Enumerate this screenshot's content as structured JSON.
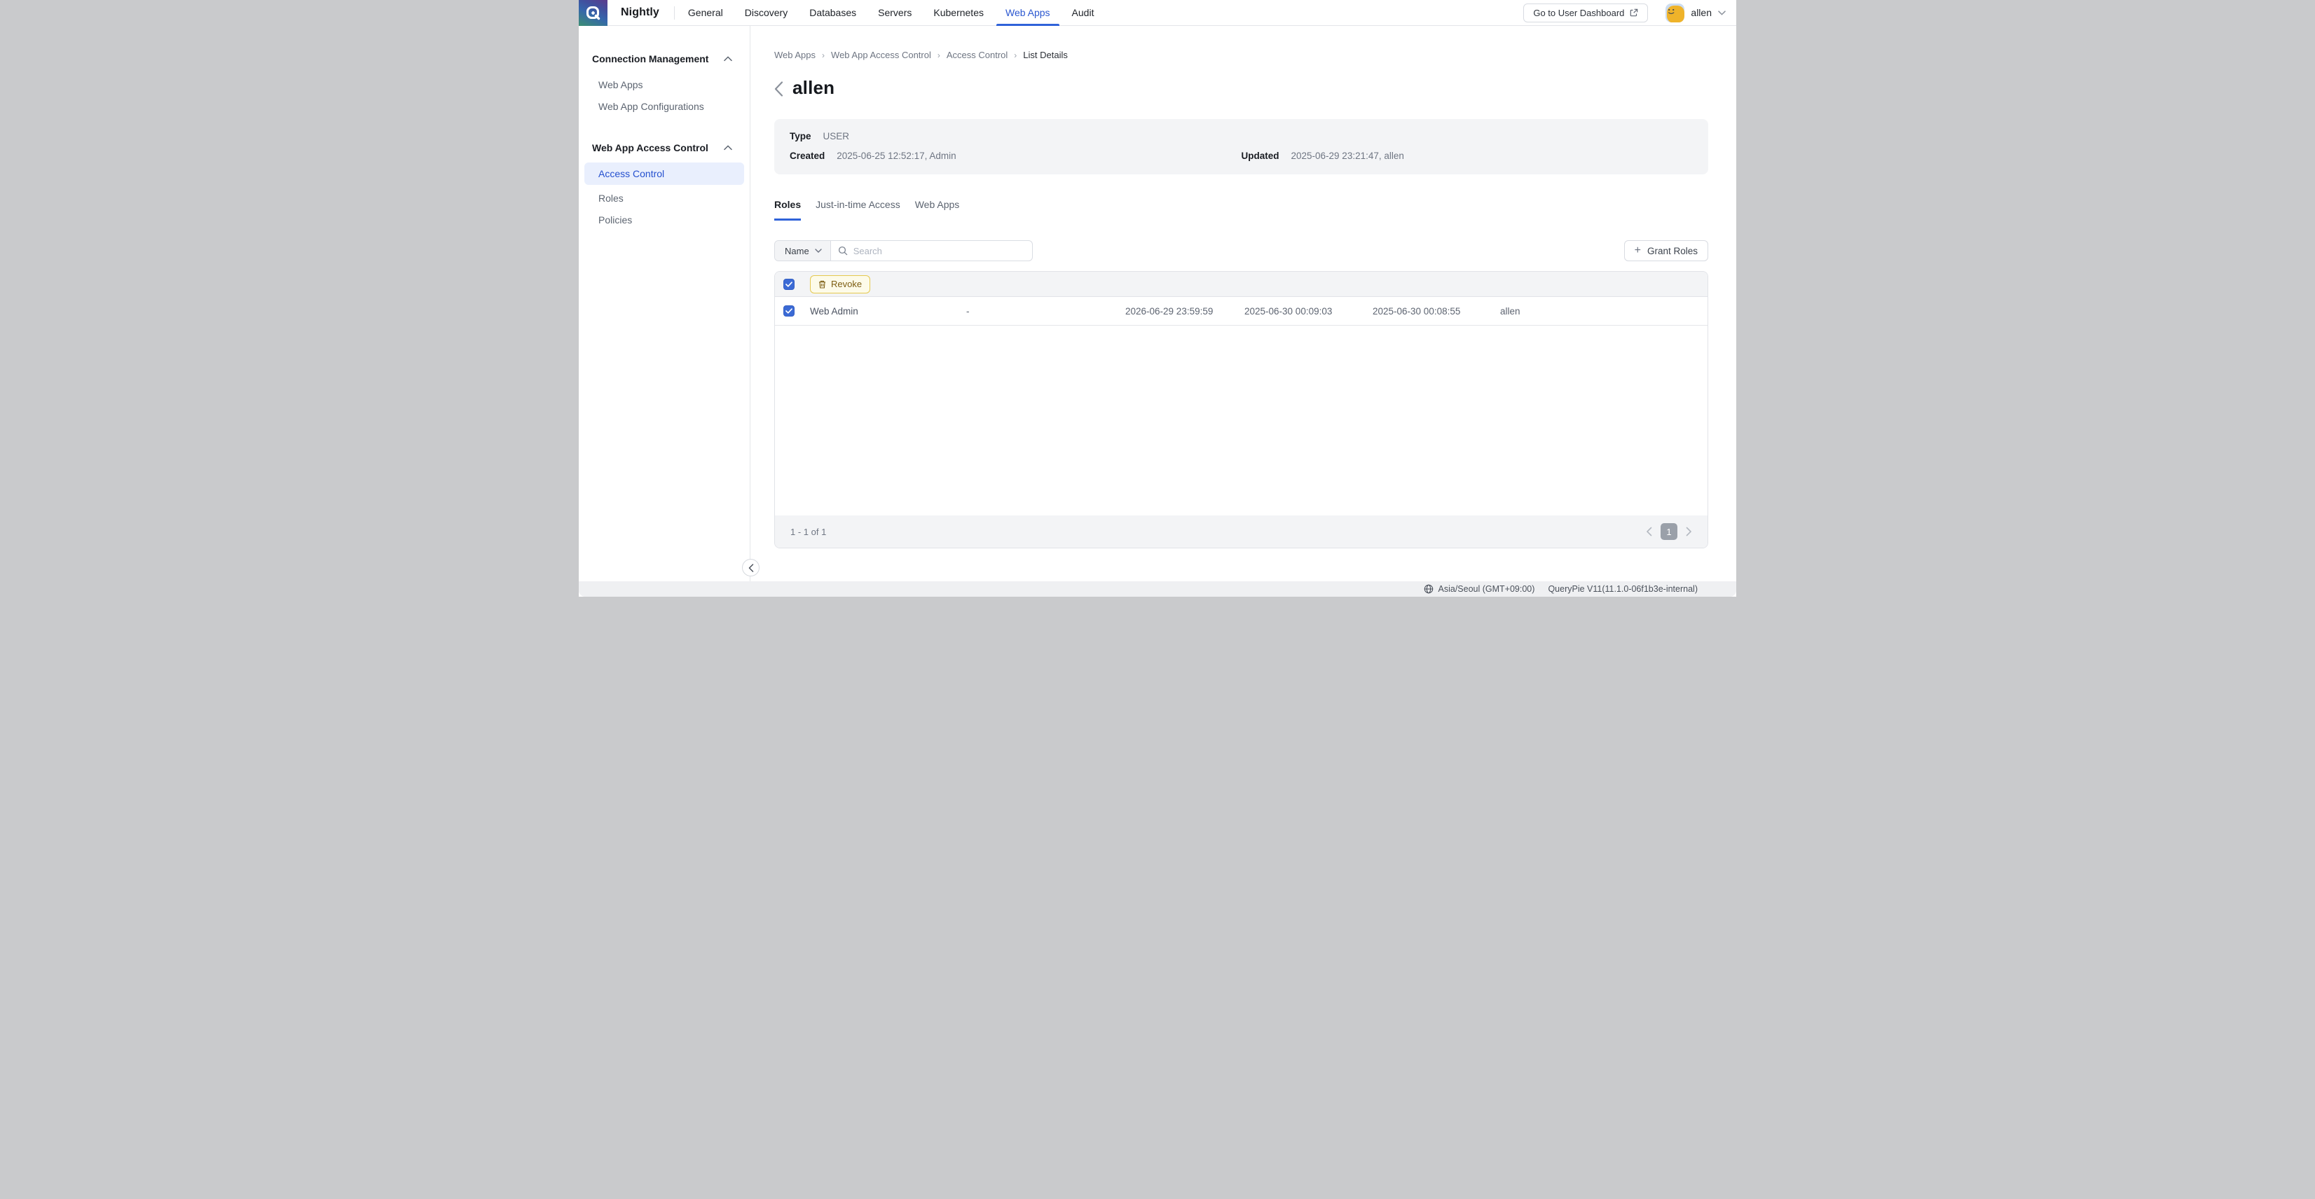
{
  "brand": {
    "name": "Nightly"
  },
  "nav": {
    "items": [
      {
        "label": "General"
      },
      {
        "label": "Discovery"
      },
      {
        "label": "Databases"
      },
      {
        "label": "Servers"
      },
      {
        "label": "Kubernetes"
      },
      {
        "label": "Web Apps"
      },
      {
        "label": "Audit"
      }
    ],
    "active": "Web Apps"
  },
  "header_right": {
    "dashboard_button": "Go to User Dashboard",
    "user_name": "allen"
  },
  "sidebar": {
    "sections": [
      {
        "title": "Connection Management",
        "items": [
          {
            "label": "Web Apps"
          },
          {
            "label": "Web App Configurations"
          }
        ]
      },
      {
        "title": "Web App Access Control",
        "items": [
          {
            "label": "Access Control",
            "selected": true
          },
          {
            "label": "Roles"
          },
          {
            "label": "Policies"
          }
        ]
      }
    ]
  },
  "breadcrumb": {
    "items": [
      {
        "label": "Web Apps"
      },
      {
        "label": "Web App Access Control"
      },
      {
        "label": "Access Control"
      },
      {
        "label": "List Details"
      }
    ]
  },
  "page": {
    "title": "allen"
  },
  "info": {
    "type_label": "Type",
    "type_value": "USER",
    "created_label": "Created",
    "created_value": "2025-06-25 12:52:17, Admin",
    "updated_label": "Updated",
    "updated_value": "2025-06-29 23:21:47, allen"
  },
  "tabs": [
    {
      "label": "Roles",
      "active": true
    },
    {
      "label": "Just-in-time Access"
    },
    {
      "label": "Web Apps"
    }
  ],
  "filter": {
    "field_selected": "Name",
    "search_placeholder": "Search",
    "grant_button": "Grant Roles"
  },
  "table": {
    "revoke_button": "Revoke",
    "select_all_checked": true,
    "rows": [
      {
        "checked": true,
        "cells": [
          "Web Admin",
          "-",
          "2026-06-29 23:59:59",
          "2025-06-30 00:09:03",
          "2025-06-30 00:08:55",
          "allen"
        ]
      }
    ],
    "footer": {
      "range": "1 - 1 of 1",
      "current_page": "1"
    }
  },
  "status_bar": {
    "timezone": "Asia/Seoul (GMT+09:00)",
    "version": "QueryPie V11(11.1.0-06f1b3e-internal)"
  },
  "colors": {
    "accent_blue": "#2f62d9",
    "nav_active": "#2b57d0",
    "checkbox_blue": "#3b6ad5",
    "selected_item_bg": "#e9effd",
    "revoke_bg": "#fdfbe9",
    "revoke_border": "#e5c94f",
    "revoke_text": "#7d5e12",
    "page_pill_bg": "#9aa0a9",
    "panel_gray": "#f3f4f6"
  }
}
